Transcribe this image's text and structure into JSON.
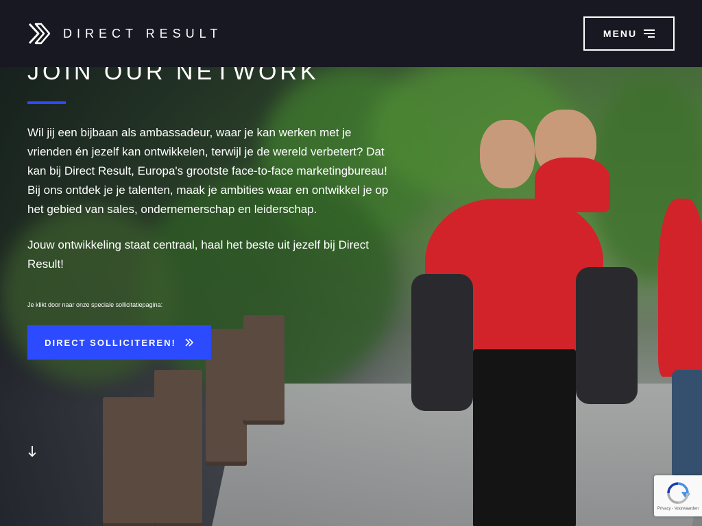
{
  "header": {
    "brand_name": "DIRECT RESULT",
    "menu_label": "MENU"
  },
  "hero": {
    "title": "JOIN OUR NETWORK",
    "paragraph_1": "Wil jij een bijbaan als ambassadeur, waar je kan werken met je vrienden én jezelf kan ontwikkelen, terwijl je de wereld verbetert? Dat kan bij Direct Result, Europa's grootste face-to-face marketingbureau! Bij ons ontdek je je talenten, maak je ambities waar en ontwikkel je op het gebied van sales, ondernemerschap en leiderschap.",
    "paragraph_2": "Jouw ontwikkeling staat centraal, haal het beste uit jezelf bij Direct Result!",
    "note": "Je klikt door naar onze speciale sollicitatiepagina:",
    "cta_label": "DIRECT SOLLICITEREN!"
  },
  "recaptcha": {
    "text": "Privacy - Voorwaarden"
  },
  "icons": {
    "logo": "double-chevron-logo-icon",
    "menu": "hamburger-icon",
    "cta": "double-chevron-right-icon",
    "scroll": "arrow-down-icon"
  },
  "colors": {
    "header_bg": "#171821",
    "accent": "#2c4bff",
    "text": "#ffffff"
  }
}
